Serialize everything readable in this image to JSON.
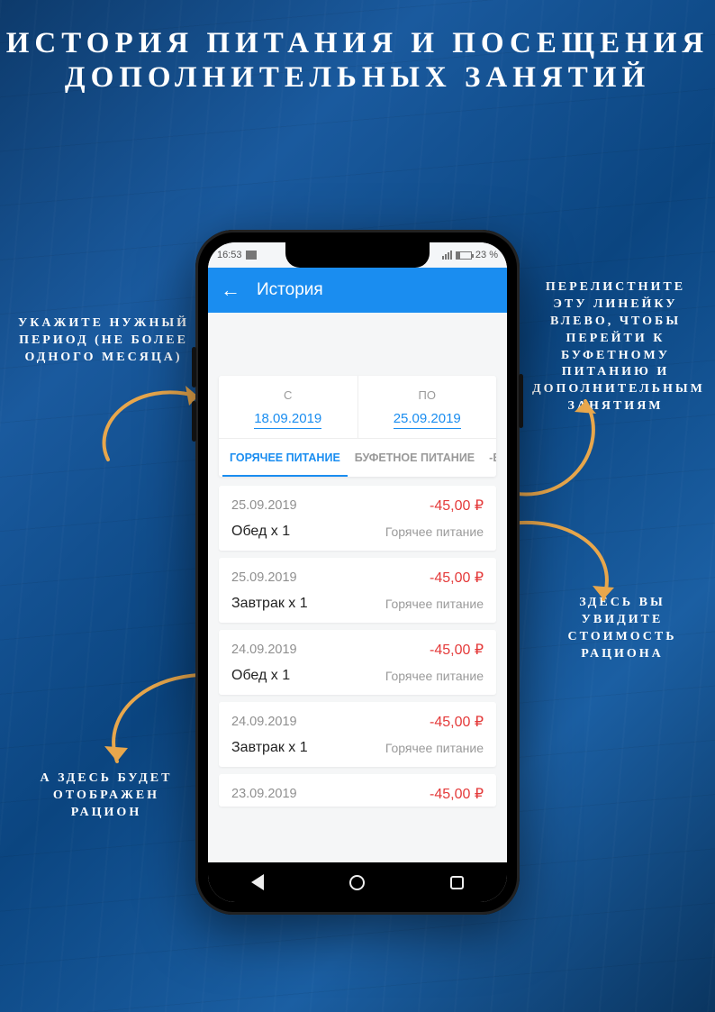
{
  "page": {
    "title": "ИСТОРИЯ ПИТАНИЯ И ПОСЕЩЕНИЯ ДОПОЛНИТЕЛЬНЫХ ЗАНЯТИЙ"
  },
  "annotations": {
    "period": "УКАЖИТЕ НУЖНЫЙ ПЕРИОД (НЕ БОЛЕЕ ОДНОГО МЕСЯЦА)",
    "swipe": "ПЕРЕЛИСТНИТЕ ЭТУ ЛИНЕЙКУ ВЛЕВО, ЧТОБЫ ПЕРЕЙТИ К БУФЕТНОМУ ПИТАНИЮ И ДОПОЛНИТЕЛЬНЫМ ЗАНЯТИЯМ",
    "price": "ЗДЕСЬ ВЫ УВИДИТЕ СТОИМОСТЬ РАЦИОНА",
    "ration": "А ЗДЕСЬ БУДЕТ ОТОБРАЖЕН РАЦИОН"
  },
  "statusbar": {
    "time": "16:53",
    "battery": "23 %"
  },
  "appbar": {
    "back_icon": "←",
    "title": "История"
  },
  "dates": {
    "from_label": "С",
    "from_value": "18.09.2019",
    "to_label": "ПО",
    "to_value": "25.09.2019"
  },
  "tabs": {
    "hot": "ГОРЯЧЕЕ ПИТАНИЕ",
    "buffet": "БУФЕТНОЕ ПИТАНИЕ",
    "extra": "-ВО"
  },
  "items": [
    {
      "date": "25.09.2019",
      "price": "-45,00 ₽",
      "name": "Обед х 1",
      "cat": "Горячее питание"
    },
    {
      "date": "25.09.2019",
      "price": "-45,00 ₽",
      "name": "Завтрак х 1",
      "cat": "Горячее питание"
    },
    {
      "date": "24.09.2019",
      "price": "-45,00 ₽",
      "name": "Обед х 1",
      "cat": "Горячее питание"
    },
    {
      "date": "24.09.2019",
      "price": "-45,00 ₽",
      "name": "Завтрак х 1",
      "cat": "Горячее питание"
    },
    {
      "date": "23.09.2019",
      "price": "-45,00 ₽",
      "name": "",
      "cat": ""
    }
  ]
}
